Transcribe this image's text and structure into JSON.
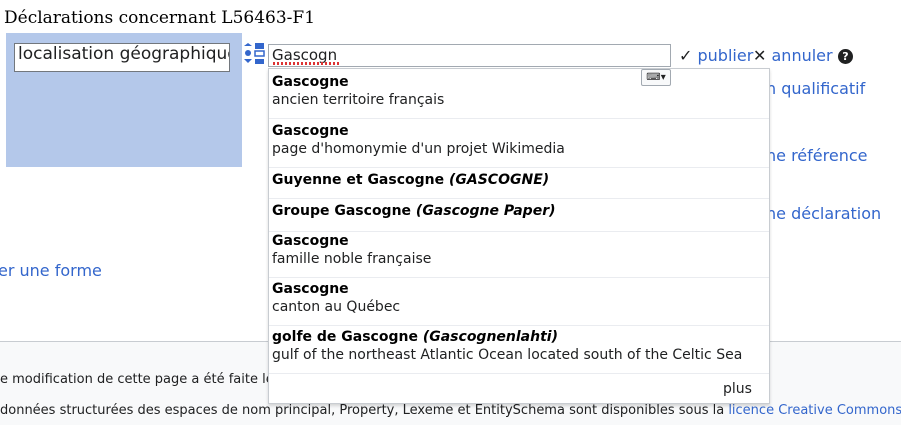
{
  "page": {
    "heading": "Déclarations concernant L56463-F1"
  },
  "editor": {
    "property_value": "localisation géographique",
    "value_text": "Gascogn",
    "publish_label": "publier",
    "cancel_label": "annuler",
    "help_symbol": "?"
  },
  "background_links": {
    "qualifier": "n qualificatif",
    "reference": "ne référence",
    "statement": "ne déclaration",
    "form": "er une forme"
  },
  "suggestions": [
    {
      "label": "Gascogne",
      "alias": "",
      "description": "ancien territoire français"
    },
    {
      "label": "Gascogne",
      "alias": "",
      "description": "page d'homonymie d'un projet Wikimedia"
    },
    {
      "label": "Guyenne et Gascogne",
      "alias": "(GASCOGNE)",
      "description": ""
    },
    {
      "label": "Groupe Gascogne",
      "alias": "(Gascogne Paper)",
      "description": ""
    },
    {
      "label": "Gascogne",
      "alias": "",
      "description": "famille noble française"
    },
    {
      "label": "Gascogne",
      "alias": "",
      "description": "canton au Québec"
    },
    {
      "label": "golfe de Gascogne",
      "alias": "(Gascognenlahti)",
      "description": "gulf of the northeast Atlantic Ocean located south of the Celtic Sea"
    }
  ],
  "dropdown": {
    "more_label": "plus"
  },
  "footer": {
    "line1": "e modification de cette page a été faite le",
    "line2_text": "données structurées des espaces de nom principal, Property, Lexeme et EntitySchema sont disponibles sous la ",
    "line2_link": "licence Creative Commons C"
  },
  "icons": {
    "check": "check-icon",
    "close": "close-icon",
    "keyboard": "keyboard-icon",
    "rank": "rank-normal-icon"
  },
  "colors": {
    "link": "#3366cc",
    "statement_bg": "#b4c8ea"
  }
}
